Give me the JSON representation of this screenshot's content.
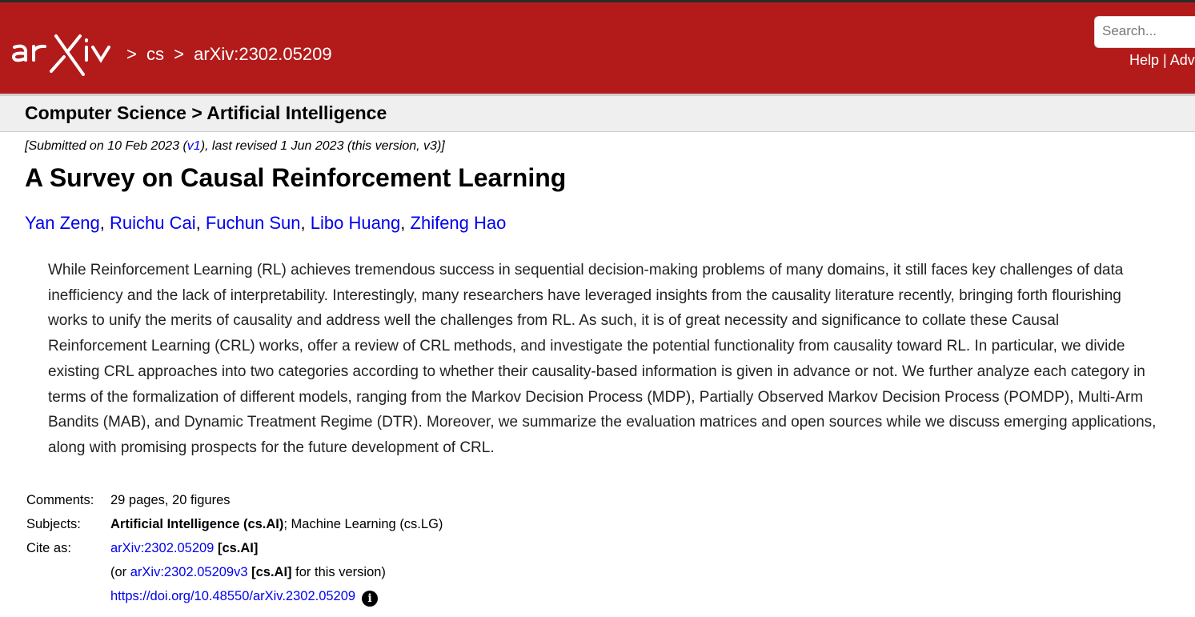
{
  "header": {
    "logo_text": "arXiv",
    "breadcrumb": [
      ">",
      "cs",
      ">",
      "arXiv:2302.05209"
    ],
    "search_placeholder": "Search...",
    "links": {
      "help": "Help",
      "sep": " | ",
      "advanced": "Adv"
    }
  },
  "subheader": {
    "title": "Computer Science > Artificial Intelligence"
  },
  "paper": {
    "dateline": {
      "prefix": "[Submitted on 10 Feb 2023 (",
      "v1": "v1",
      "suffix": "), last revised 1 Jun 2023 (this version, v3)]"
    },
    "title": "A Survey on Causal Reinforcement Learning",
    "authors": [
      "Yan Zeng",
      "Ruichu Cai",
      "Fuchun Sun",
      "Libo Huang",
      "Zhifeng Hao"
    ],
    "author_sep": ", ",
    "abstract": "While Reinforcement Learning (RL) achieves tremendous success in sequential decision-making problems of many domains, it still faces key challenges of data inefficiency and the lack of interpretability. Interestingly, many researchers have leveraged insights from the causality literature recently, bringing forth flourishing works to unify the merits of causality and address well the challenges from RL. As such, it is of great necessity and significance to collate these Causal Reinforcement Learning (CRL) works, offer a review of CRL methods, and investigate the potential functionality from causality toward RL. In particular, we divide existing CRL approaches into two categories according to whether their causality-based information is given in advance or not. We further analyze each category in terms of the formalization of different models, ranging from the Markov Decision Process (MDP), Partially Observed Markov Decision Process (POMDP), Multi-Arm Bandits (MAB), and Dynamic Treatment Regime (DTR). Moreover, we summarize the evaluation matrices and open sources while we discuss emerging applications, along with promising prospects for the future development of CRL."
  },
  "meta": {
    "comments_label": "Comments:",
    "comments": "29 pages, 20 figures",
    "subjects_label": "Subjects:",
    "subjects_primary": "Artificial Intelligence (cs.AI)",
    "subjects_rest": "; Machine Learning (cs.LG)",
    "cite_label": "Cite as:",
    "cite_id": "arXiv:2302.05209",
    "cite_cat": "[cs.AI]",
    "cite_version_prefix": "(or ",
    "cite_version_id": "arXiv:2302.05209v3",
    "cite_version_cat": "[cs.AI]",
    "cite_version_suffix": " for this version)",
    "doi": "https://doi.org/10.48550/arXiv.2302.05209",
    "info_icon": "i"
  },
  "colors": {
    "brand": "#b31b1b",
    "link": "#0000ee"
  }
}
